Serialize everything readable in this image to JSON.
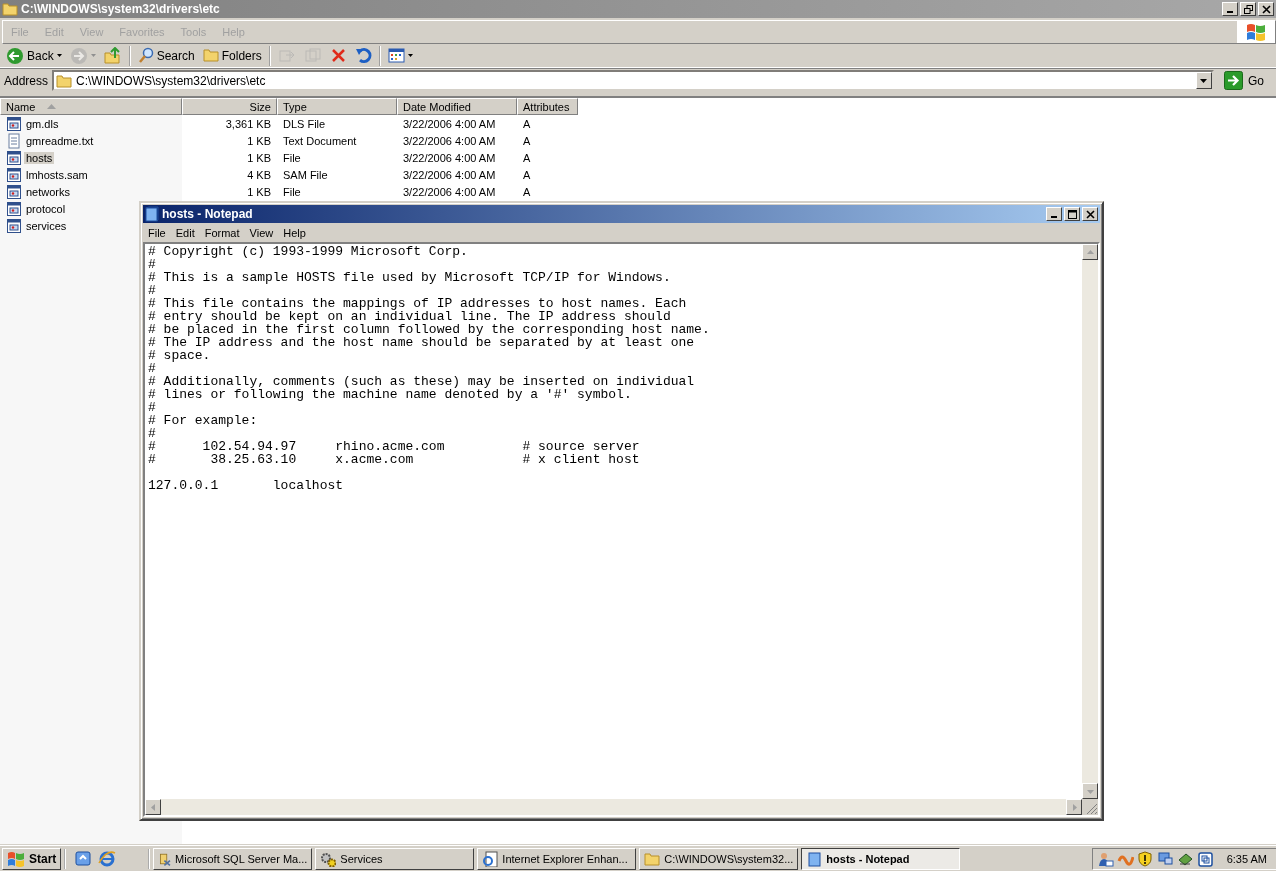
{
  "explorer": {
    "title": "C:\\WINDOWS\\system32\\drivers\\etc",
    "menu": [
      "File",
      "Edit",
      "View",
      "Favorites",
      "Tools",
      "Help"
    ],
    "toolbar": [
      {
        "kind": "back",
        "label": "Back",
        "disabled": false
      },
      {
        "kind": "forward",
        "disabled": true
      },
      {
        "kind": "up",
        "disabled": false
      },
      {
        "kind": "search",
        "label": "Search",
        "disabled": false
      },
      {
        "kind": "folders",
        "label": "Folders",
        "disabled": false
      },
      {
        "kind": "move",
        "disabled": true
      },
      {
        "kind": "copy",
        "disabled": true
      },
      {
        "kind": "delete",
        "disabled": false
      },
      {
        "kind": "undo",
        "disabled": false
      },
      {
        "kind": "views",
        "disabled": false
      }
    ],
    "address": {
      "label": "Address",
      "value": "C:\\WINDOWS\\system32\\drivers\\etc",
      "go": "Go"
    },
    "columns": [
      {
        "label": "Name",
        "sorted": true
      },
      {
        "label": "Size",
        "sorted": false
      },
      {
        "label": "Type",
        "sorted": false
      },
      {
        "label": "Date Modified",
        "sorted": false
      },
      {
        "label": "Attributes",
        "sorted": false
      }
    ],
    "files": [
      {
        "name": "gm.dls",
        "size": "3,361 KB",
        "type": "DLS File",
        "date": "3/22/2006 4:00 AM",
        "attributes": "A",
        "kind": "file",
        "selected": false
      },
      {
        "name": "gmreadme.txt",
        "size": "1 KB",
        "type": "Text Document",
        "date": "3/22/2006 4:00 AM",
        "attributes": "A",
        "kind": "text",
        "selected": false
      },
      {
        "name": "hosts",
        "size": "1 KB",
        "type": "File",
        "date": "3/22/2006 4:00 AM",
        "attributes": "A",
        "kind": "file",
        "selected": true
      },
      {
        "name": "lmhosts.sam",
        "size": "4 KB",
        "type": "SAM File",
        "date": "3/22/2006 4:00 AM",
        "attributes": "A",
        "kind": "file",
        "selected": false
      },
      {
        "name": "networks",
        "size": "1 KB",
        "type": "File",
        "date": "3/22/2006 4:00 AM",
        "attributes": "A",
        "kind": "file",
        "selected": false
      },
      {
        "name": "protocol",
        "kind": "file",
        "selected": false
      },
      {
        "name": "services",
        "kind": "file",
        "selected": false
      }
    ]
  },
  "notepad": {
    "title": "hosts - Notepad",
    "menu": [
      "File",
      "Edit",
      "Format",
      "View",
      "Help"
    ],
    "text": "# Copyright (c) 1993-1999 Microsoft Corp.\n#\n# This is a sample HOSTS file used by Microsoft TCP/IP for Windows.\n#\n# This file contains the mappings of IP addresses to host names. Each\n# entry should be kept on an individual line. The IP address should\n# be placed in the first column followed by the corresponding host name.\n# The IP address and the host name should be separated by at least one\n# space.\n#\n# Additionally, comments (such as these) may be inserted on individual\n# lines or following the machine name denoted by a '#' symbol.\n#\n# For example:\n#\n#      102.54.94.97     rhino.acme.com          # source server\n#       38.25.63.10     x.acme.com              # x client host\n\n127.0.0.1       localhost"
  },
  "taskbar": {
    "start": "Start",
    "tasks": [
      {
        "label": "Microsoft SQL Server Ma...",
        "kind": "sql",
        "selected": false
      },
      {
        "label": "Services",
        "kind": "services",
        "selected": false
      },
      {
        "label": "Internet Explorer Enhan...",
        "kind": "document",
        "selected": false
      },
      {
        "label": "C:\\WINDOWS\\system32...",
        "kind": "folder",
        "selected": false
      },
      {
        "label": "hosts - Notepad",
        "kind": "notepad",
        "selected": true
      }
    ],
    "clock": "6:35 AM"
  }
}
